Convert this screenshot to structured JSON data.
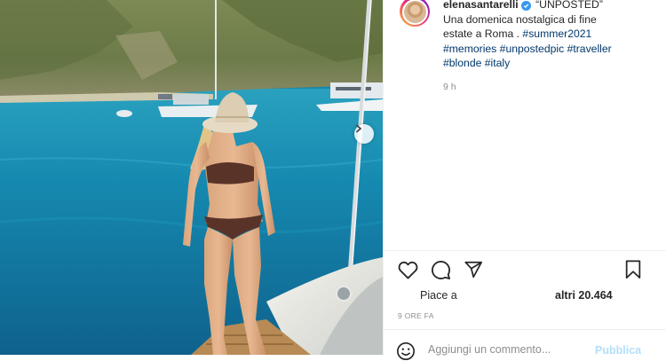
{
  "post": {
    "username": "elenasantarelli",
    "verified": true,
    "caption_lines": [
      "“UNPOSTED”",
      "Una domenica nostalgica di fine",
      "estate a Roma . ",
      ""
    ],
    "caption_inline_tag": "#summer2021",
    "hashtags_line1": [
      "#memories",
      "#unpostedpic",
      "#traveller"
    ],
    "hashtags_line2": [
      "#blonde",
      "#italy"
    ],
    "time_ago": "9 h",
    "likes_prefix": "Piace a",
    "likes_suffix": "altri 20.464",
    "date_label": "9 ORE FA"
  },
  "actions": {
    "like": "heart-icon",
    "comment": "comment-icon",
    "share": "paper-plane-icon",
    "save": "bookmark-icon"
  },
  "comment_box": {
    "placeholder": "Aggiungi un commento...",
    "publish_label": "Pubblica"
  },
  "colors": {
    "text": "#262626",
    "secondary": "#8e8e8e",
    "hashtag": "#00376b",
    "verified": "#3897f0",
    "publish_disabled": "#b2dffc"
  }
}
